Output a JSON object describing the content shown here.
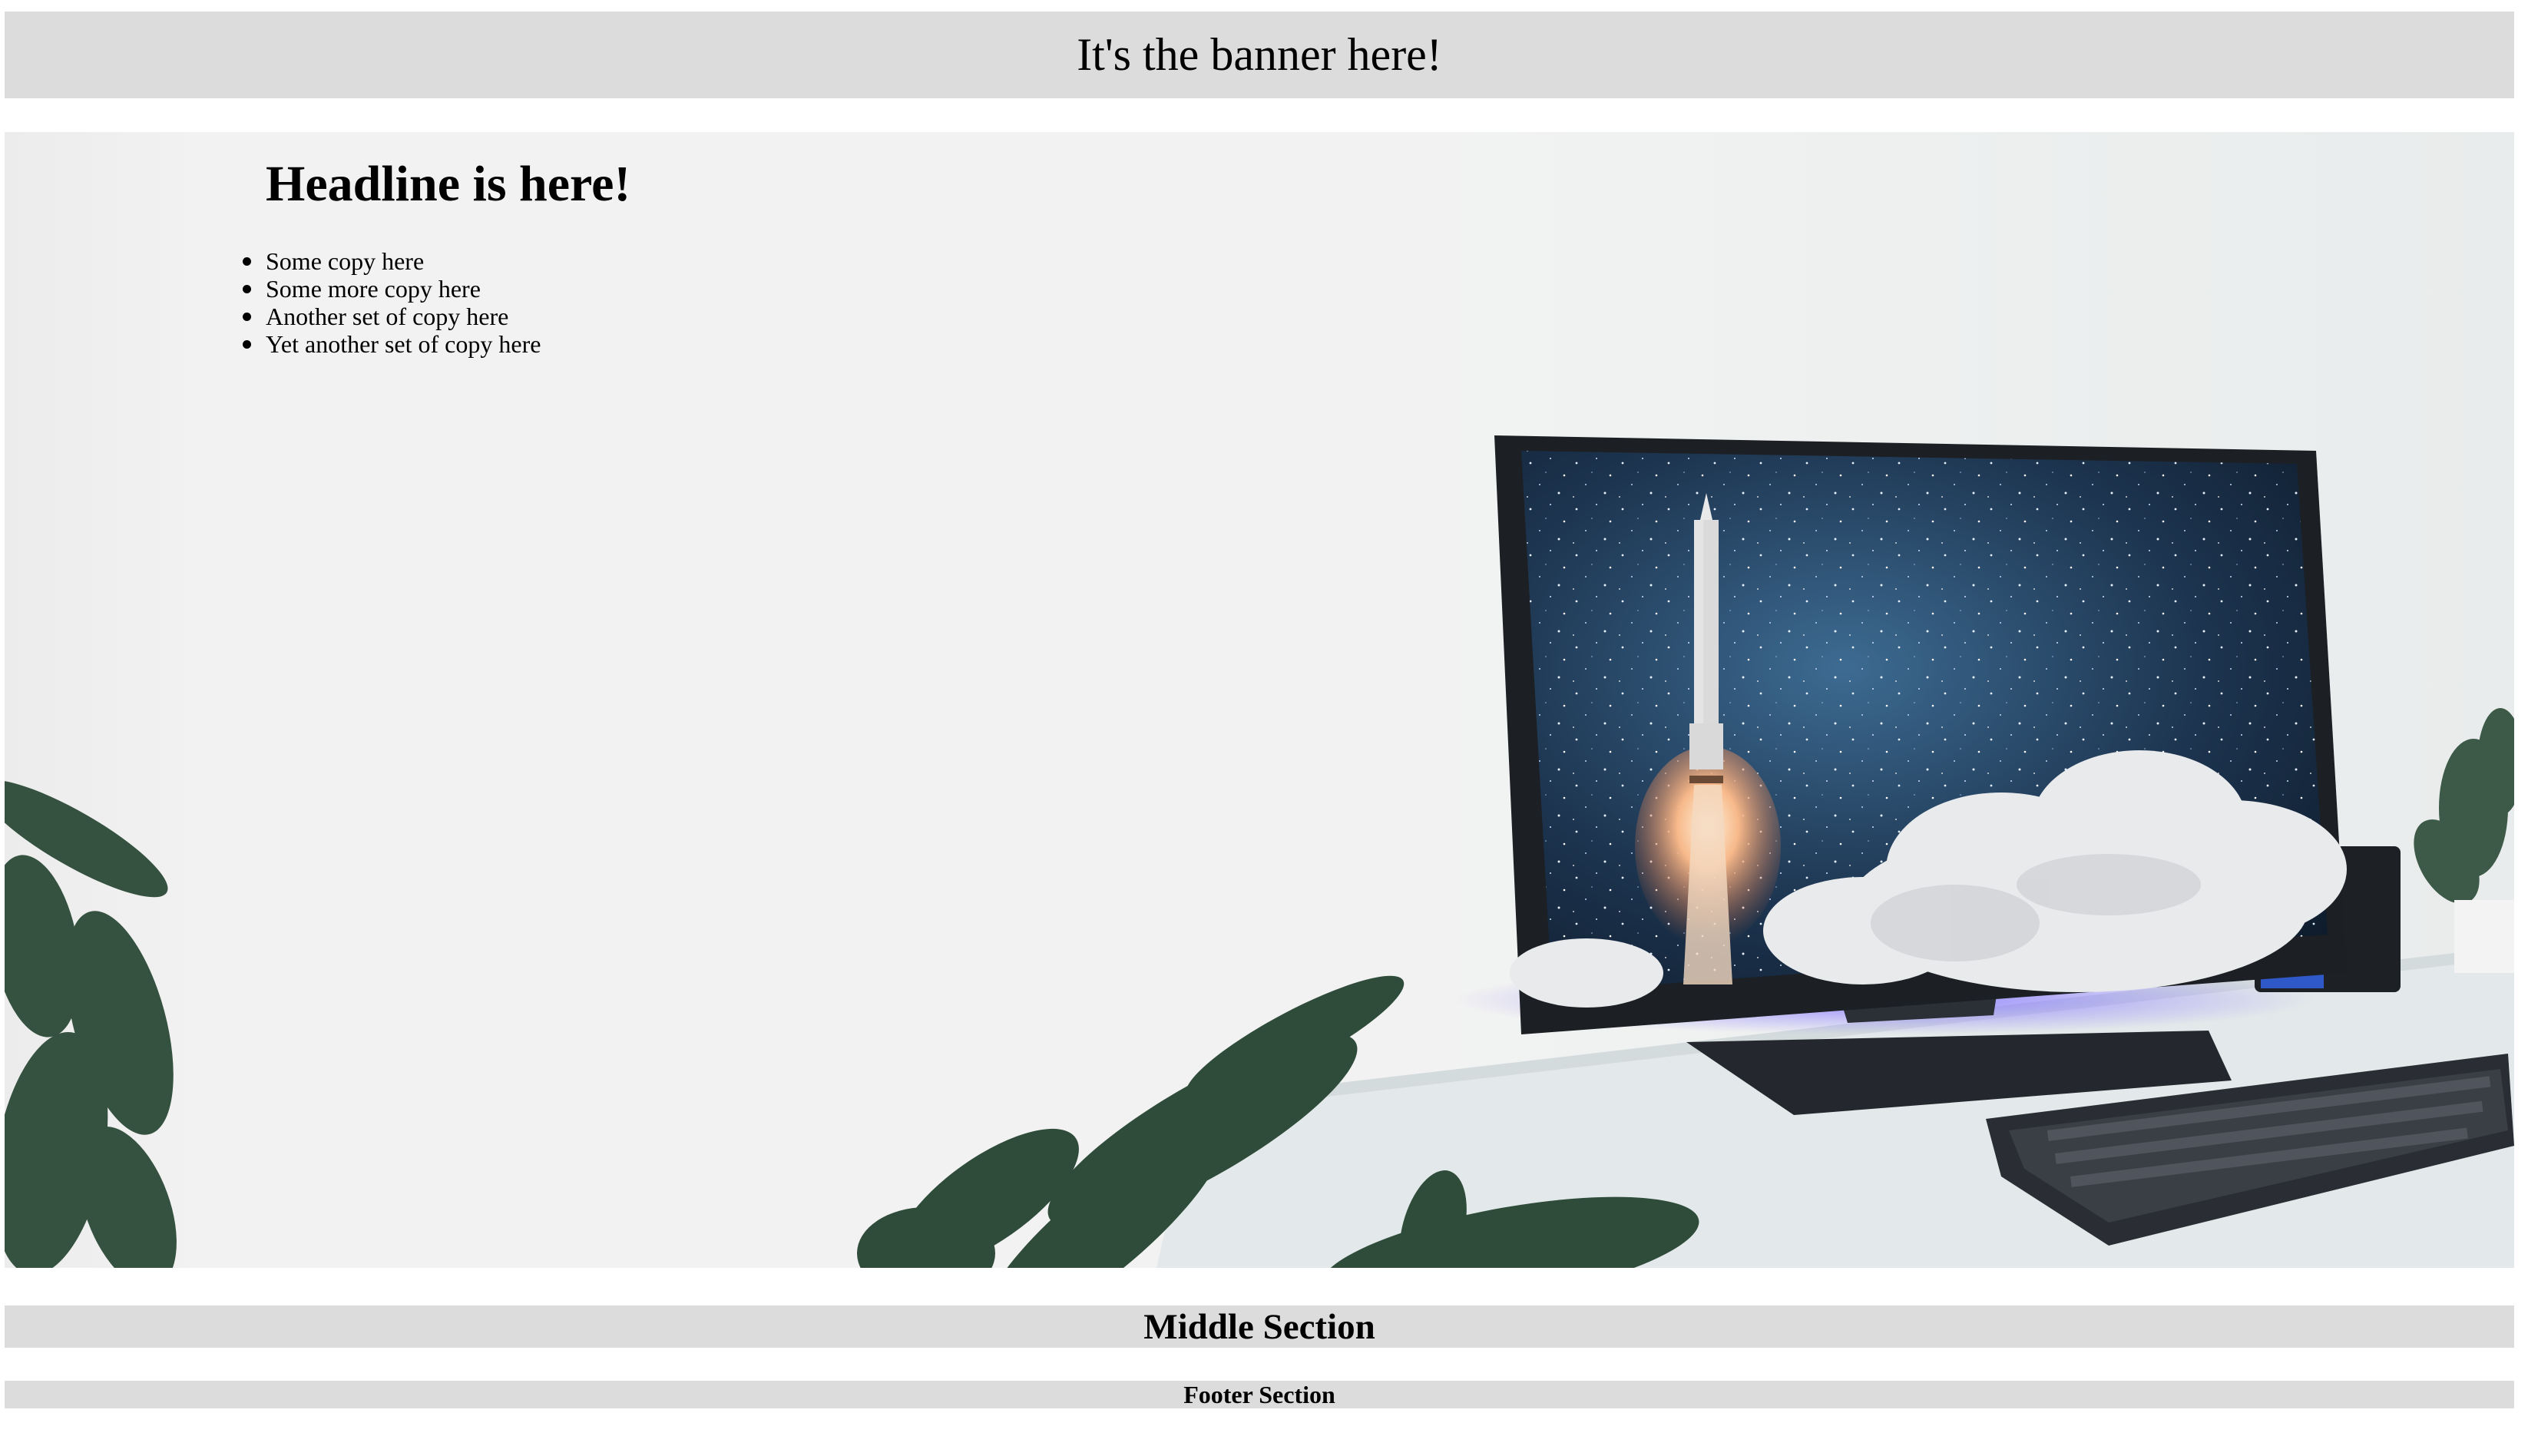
{
  "banner": {
    "text": "It's the banner here!"
  },
  "hero": {
    "headline": "Headline is here!",
    "copy_items": [
      "Some copy here",
      "Some more copy here",
      "Another set of copy here",
      "Yet another set of copy here"
    ],
    "image_icon": "desk-monitor-rocket-illustration"
  },
  "middle": {
    "title": "Middle Section"
  },
  "footer": {
    "title": "Footer Section"
  },
  "colors": {
    "section_bg": "#dcdcdc",
    "hero_bg": "#f2f2f2",
    "text": "#000000"
  }
}
